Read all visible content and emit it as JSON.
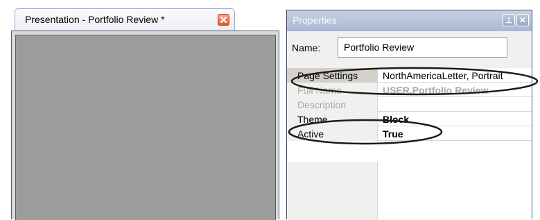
{
  "document": {
    "tab_title": "Presentation - Portfolio Review *"
  },
  "properties": {
    "title": "Properties",
    "pin_glyph": "⊥",
    "close_glyph": "✕",
    "name_label": "Name:",
    "name_value": "Portfolio Review",
    "rows": [
      {
        "key": "Page Settings",
        "value": "NorthAmericaLetter, Portrait"
      },
      {
        "key": "Full Name",
        "value": "USER.Portfolio Review"
      },
      {
        "key": "Description",
        "value": ""
      },
      {
        "key": "Theme",
        "value": "Block"
      },
      {
        "key": "Active",
        "value": "True"
      }
    ]
  },
  "colors": {
    "title_bar": "#aab8d0",
    "close_button": "#e4582f",
    "canvas": "#9c9c9c"
  }
}
